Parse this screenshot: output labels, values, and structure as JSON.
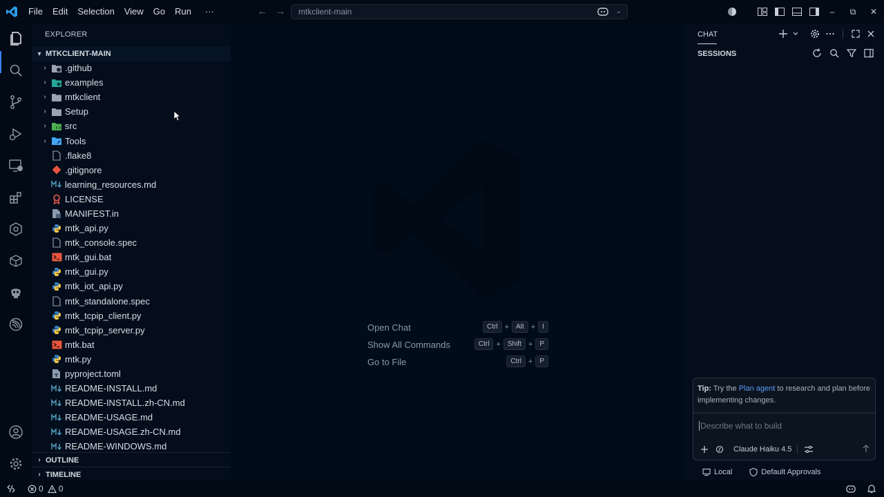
{
  "titlebar": {
    "menu": [
      "File",
      "Edit",
      "Selection",
      "View",
      "Go",
      "Run",
      "···"
    ],
    "command_center_text": "mtkclient-main"
  },
  "explorer": {
    "title": "EXPLORER",
    "root_folder": "MTKCLIENT-MAIN",
    "items": [
      {
        "label": ".github",
        "type": "folder",
        "icon": "github-folder-icon",
        "color": "#9aa4b2"
      },
      {
        "label": "examples",
        "type": "folder",
        "icon": "examples-folder-icon",
        "color": "#26a69a"
      },
      {
        "label": "mtkclient",
        "type": "folder",
        "icon": "folder-icon",
        "color": "#9aa4b2"
      },
      {
        "label": "Setup",
        "type": "folder",
        "icon": "folder-icon",
        "color": "#9aa4b2"
      },
      {
        "label": "src",
        "type": "folder",
        "icon": "src-folder-icon",
        "color": "#4caf50"
      },
      {
        "label": "Tools",
        "type": "folder",
        "icon": "tools-folder-icon",
        "color": "#42a5f5"
      },
      {
        "label": ".flake8",
        "type": "file",
        "icon": "file-icon",
        "color": "#9aa4b2"
      },
      {
        "label": ".gitignore",
        "type": "file",
        "icon": "git-icon",
        "color": "#e8553e"
      },
      {
        "label": "learning_resources.md",
        "type": "file",
        "icon": "markdown-icon",
        "color": "#519aba"
      },
      {
        "label": "LICENSE",
        "type": "file",
        "icon": "license-icon",
        "color": "#f05b4b"
      },
      {
        "label": "MANIFEST.in",
        "type": "file",
        "icon": "manifest-icon",
        "color": "#8a9bb0"
      },
      {
        "label": "mtk_api.py",
        "type": "file",
        "icon": "python-icon",
        "color": "#3b82c4"
      },
      {
        "label": "mtk_console.spec",
        "type": "file",
        "icon": "file-icon",
        "color": "#9aa4b2"
      },
      {
        "label": "mtk_gui.bat",
        "type": "file",
        "icon": "terminal-icon",
        "color": "#e8553e"
      },
      {
        "label": "mtk_gui.py",
        "type": "file",
        "icon": "python-icon",
        "color": "#3b82c4"
      },
      {
        "label": "mtk_iot_api.py",
        "type": "file",
        "icon": "python-icon",
        "color": "#3b82c4"
      },
      {
        "label": "mtk_standalone.spec",
        "type": "file",
        "icon": "file-icon",
        "color": "#9aa4b2"
      },
      {
        "label": "mtk_tcpip_client.py",
        "type": "file",
        "icon": "python-icon",
        "color": "#3b82c4"
      },
      {
        "label": "mtk_tcpip_server.py",
        "type": "file",
        "icon": "python-icon",
        "color": "#3b82c4"
      },
      {
        "label": "mtk.bat",
        "type": "file",
        "icon": "terminal-icon",
        "color": "#e8553e"
      },
      {
        "label": "mtk.py",
        "type": "file",
        "icon": "python-icon",
        "color": "#3b82c4"
      },
      {
        "label": "pyproject.toml",
        "type": "file",
        "icon": "toml-icon",
        "color": "#8a9bb0"
      },
      {
        "label": "README-INSTALL.md",
        "type": "file",
        "icon": "markdown-icon",
        "color": "#519aba"
      },
      {
        "label": "README-INSTALL.zh-CN.md",
        "type": "file",
        "icon": "markdown-icon",
        "color": "#519aba"
      },
      {
        "label": "README-USAGE.md",
        "type": "file",
        "icon": "markdown-icon",
        "color": "#519aba"
      },
      {
        "label": "README-USAGE.zh-CN.md",
        "type": "file",
        "icon": "markdown-icon",
        "color": "#519aba"
      },
      {
        "label": "README-WINDOWS.md",
        "type": "file",
        "icon": "markdown-icon",
        "color": "#519aba"
      }
    ],
    "outline_label": "OUTLINE",
    "timeline_label": "TIMELINE"
  },
  "editor": {
    "shortcuts": [
      {
        "label": "Open Chat",
        "keys": [
          "Ctrl",
          "Alt",
          "I"
        ]
      },
      {
        "label": "Show All Commands",
        "keys": [
          "Ctrl",
          "Shift",
          "P"
        ]
      },
      {
        "label": "Go to File",
        "keys": [
          "Ctrl",
          "P"
        ]
      }
    ]
  },
  "chat": {
    "tab_label": "CHAT",
    "sessions_label": "SESSIONS",
    "tip_prefix": "Tip:",
    "tip_before_link": " Try the ",
    "tip_link": "Plan agent",
    "tip_after_link": " to research and plan before implementing changes.",
    "input_placeholder": "Describe what to build",
    "model": "Claude Haiku 4.5",
    "footer_local": "Local",
    "footer_approvals": "Default Approvals"
  },
  "statusbar": {
    "errors": "0",
    "warnings": "0"
  },
  "colors": {
    "accent": "#3b82f6",
    "link": "#5b9cf5",
    "background": "#020a16"
  }
}
